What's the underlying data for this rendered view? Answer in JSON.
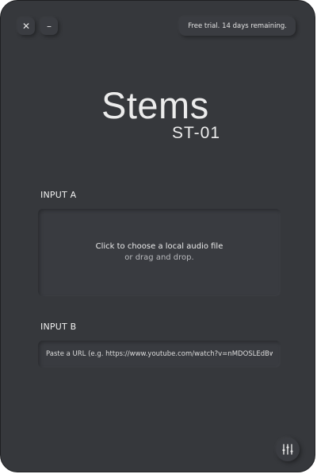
{
  "window_controls": {
    "close_icon": "✕",
    "minimize_icon": "–"
  },
  "trial": {
    "text": "Free trial. 14 days remaining."
  },
  "brand": {
    "name": "Stems",
    "model": "ST-01"
  },
  "input_a": {
    "label": "INPUT A",
    "primary_text": "Click to choose a local audio file",
    "secondary_text": "or drag and drop."
  },
  "input_b": {
    "label": "INPUT B",
    "placeholder": "Paste a URL (e.g. https://www.youtube.com/watch?v=nMDOSLEdBw)",
    "value": ""
  },
  "settings": {
    "icon": "mixer-sliders-icon"
  },
  "colors": {
    "background": "#36383c",
    "surface": "#393b40",
    "text": "#ececec",
    "muted_text": "#b8b9bc"
  }
}
